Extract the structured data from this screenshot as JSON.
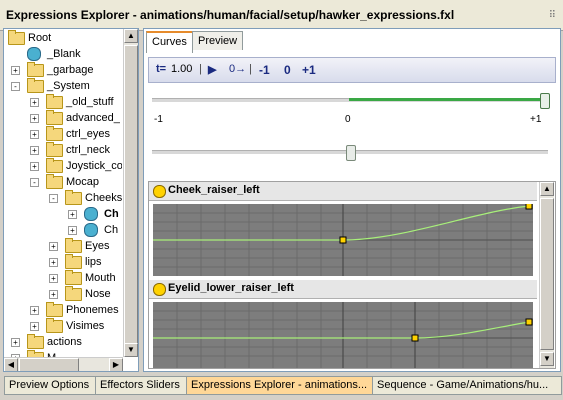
{
  "window": {
    "title": "Expressions Explorer - animations/human/facial/setup/hawker_expressions.fxl"
  },
  "tree": {
    "items": [
      {
        "label": "Root",
        "icon": "folder",
        "expander": "-"
      },
      {
        "label": "_Blank",
        "icon": "face",
        "expander": ""
      },
      {
        "label": "_garbage",
        "icon": "folder",
        "expander": "+"
      },
      {
        "label": "_System",
        "icon": "folder",
        "expander": "-"
      },
      {
        "label": "_old_stuff",
        "icon": "folder",
        "expander": "+"
      },
      {
        "label": "advanced_",
        "icon": "folder",
        "expander": "+"
      },
      {
        "label": "ctrl_eyes",
        "icon": "folder",
        "expander": "+"
      },
      {
        "label": "ctrl_neck",
        "icon": "folder",
        "expander": "+"
      },
      {
        "label": "Joystick_co",
        "icon": "folder",
        "expander": "+"
      },
      {
        "label": "Mocap",
        "icon": "folder",
        "expander": "-"
      },
      {
        "label": "Cheeks",
        "icon": "folder",
        "expander": "-"
      },
      {
        "label": "Ch",
        "icon": "face",
        "expander": "+"
      },
      {
        "label": "Ch",
        "icon": "face",
        "expander": "+"
      },
      {
        "label": "Eyes",
        "icon": "folder",
        "expander": "+"
      },
      {
        "label": "lips",
        "icon": "folder",
        "expander": "+"
      },
      {
        "label": "Mouth",
        "icon": "folder",
        "expander": "+"
      },
      {
        "label": "Nose",
        "icon": "folder",
        "expander": "+"
      },
      {
        "label": "Phonemes",
        "icon": "folder",
        "expander": "+"
      },
      {
        "label": "Visimes",
        "icon": "folder",
        "expander": "+"
      },
      {
        "label": "actions",
        "icon": "folder",
        "expander": "+"
      },
      {
        "label": "M",
        "icon": "folder",
        "expander": "+"
      }
    ]
  },
  "tabs": [
    {
      "label": "Curves"
    },
    {
      "label": "Preview"
    }
  ],
  "toolbar": {
    "time_label": "t=",
    "time_value": "1.00",
    "play_icon": "play-icon",
    "goto_zero_label": "0→",
    "minus_one": "-1",
    "zero": "0",
    "plus_one": "+1"
  },
  "slider": {
    "tick_min": "-1",
    "tick_mid": "0",
    "tick_max": "+1",
    "value": 1.0
  },
  "curves": [
    {
      "name": "Cheek_raiser_left"
    },
    {
      "name": "Eyelid_lower_raiser_left"
    }
  ],
  "bottom_tabs": [
    {
      "label": "Preview Options"
    },
    {
      "label": "Effectors Sliders"
    },
    {
      "label": "Expressions Explorer - animations..."
    },
    {
      "label": "Sequence - Game/Animations/hu..."
    }
  ],
  "colors": {
    "accent_tab": "#e68b2c",
    "slider_fill": "#3aa845",
    "curve_color": "#a8f07a",
    "graph_bg": "#7d7d7d"
  }
}
